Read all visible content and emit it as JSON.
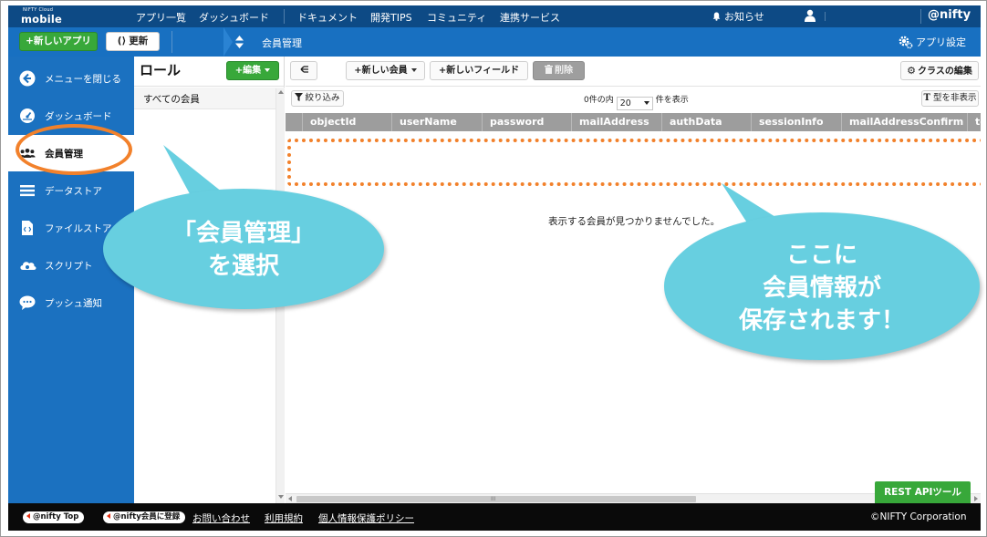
{
  "topnav": {
    "logo_small": "NIFTY Cloud",
    "logo_big": "mobile backend",
    "links": [
      "アプリ一覧",
      "ダッシュボード",
      "ドキュメント",
      "開発TIPS",
      "コミュニティ",
      "連携サービス"
    ],
    "notice": "お知らせ",
    "brand": "@nifty"
  },
  "bluebar": {
    "new_app": "+新しいアプリ",
    "refresh": "更新",
    "breadcrumb": "会員管理",
    "app_settings": "アプリ設定"
  },
  "sidebar": {
    "items": [
      {
        "label": "メニューを閉じる",
        "icon": "arrow-left-circle-icon"
      },
      {
        "label": "ダッシュボード",
        "icon": "gauge-icon"
      },
      {
        "label": "会員管理",
        "icon": "users-icon",
        "active": true
      },
      {
        "label": "データストア",
        "icon": "list-icon"
      },
      {
        "label": "ファイルストア",
        "icon": "file-icon"
      },
      {
        "label": "スクリプト",
        "icon": "cloud-script-icon"
      },
      {
        "label": "プッシュ通知",
        "icon": "chat-bubble-icon"
      }
    ]
  },
  "roles": {
    "title": "ロール",
    "edit": "+編集",
    "all_members": "すべての会員"
  },
  "main": {
    "new_member": "+新しい会員",
    "new_field": "+新しいフィールド",
    "delete": "削除",
    "class_edit": "クラスの編集",
    "filter": "絞り込み",
    "pager_prefix": "0件の内",
    "page_size": "20",
    "pager_suffix": "件を表示",
    "hide_type": "型を非表示",
    "columns": [
      "objectId",
      "userName",
      "password",
      "mailAddress",
      "authData",
      "sessionInfo",
      "mailAddressConfirm",
      "te"
    ],
    "empty_message": "表示する会員が見つかりませんでした。",
    "scroll_grip": "III",
    "rest_api": "REST APIツール"
  },
  "footer": {
    "nifty_top": "@nifty Top",
    "register": "@nifty会員に登録",
    "links": [
      "お問い合わせ",
      "利用規約",
      "個人情報保護ポリシー"
    ],
    "copyright": "©NIFTY Corporation"
  },
  "annotations": {
    "left_line1": "「会員管理」",
    "left_line2": "を選択",
    "right_line1": "ここに",
    "right_line2": "会員情報が",
    "right_line3": "保存されます！",
    "highlight_color": "#f2812b",
    "bubble_color": "#67cfe0"
  },
  "colors": {
    "nav_dark": "#0d4a85",
    "toolbar_blue": "#1870c1",
    "accent_green": "#38a83a",
    "header_gray": "#9d9d9d"
  }
}
